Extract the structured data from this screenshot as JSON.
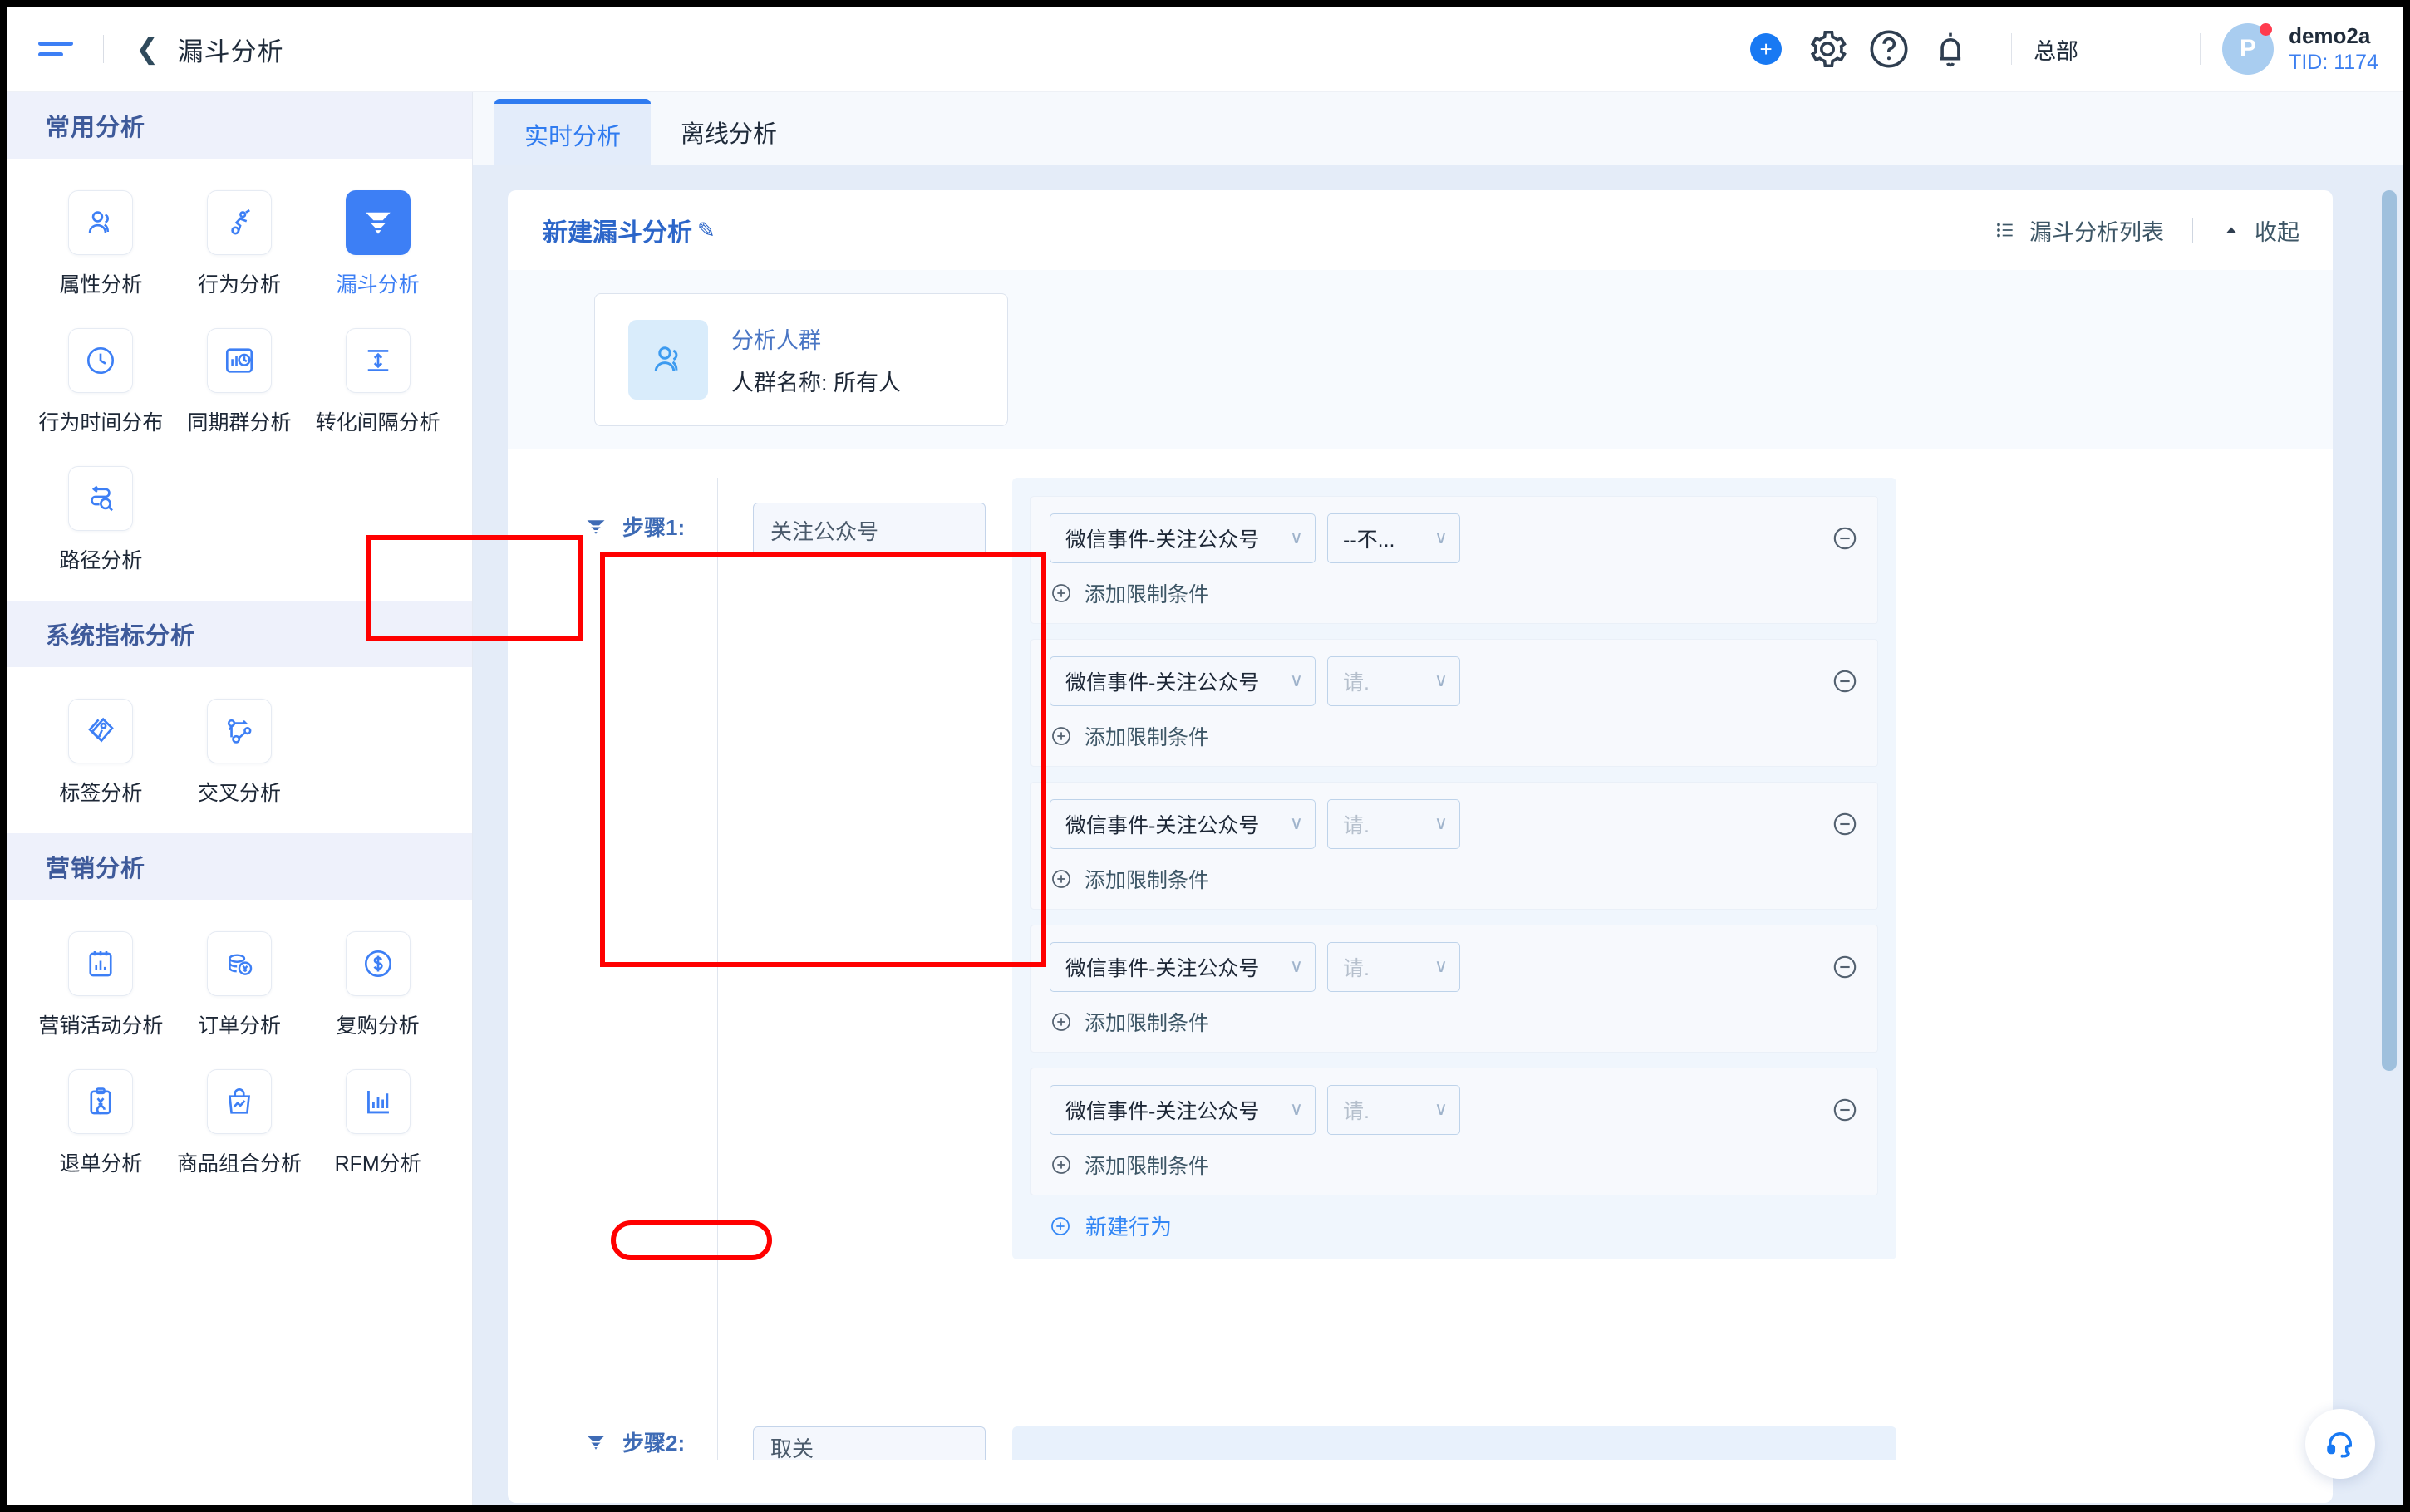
{
  "topbar": {
    "menu_icon": "hamburger-icon",
    "back_icon": "chevron-left-icon",
    "title": "漏斗分析",
    "icons": [
      "plus-icon",
      "gear-icon",
      "help-icon",
      "bell-icon"
    ],
    "org": "总部",
    "avatar_initial": "P",
    "user_name": "demo2a",
    "user_tid": "TID: 1174"
  },
  "sidebar": {
    "sections": [
      {
        "title": "常用分析",
        "items": [
          {
            "label": "属性分析",
            "icon": "users-icon",
            "active": false
          },
          {
            "label": "行为分析",
            "icon": "behavior-icon",
            "active": false
          },
          {
            "label": "漏斗分析",
            "icon": "funnel-icon",
            "active": true
          },
          {
            "label": "行为时间分布",
            "icon": "clock-icon",
            "active": false
          },
          {
            "label": "同期群分析",
            "icon": "cohort-icon",
            "active": false
          },
          {
            "label": "转化间隔分析",
            "icon": "interval-icon",
            "active": false
          },
          {
            "label": "路径分析",
            "icon": "path-search-icon",
            "active": false
          }
        ]
      },
      {
        "title": "系统指标分析",
        "items": [
          {
            "label": "标签分析",
            "icon": "tag-icon",
            "active": false
          },
          {
            "label": "交叉分析",
            "icon": "cross-icon",
            "active": false
          }
        ]
      },
      {
        "title": "营销分析",
        "items": [
          {
            "label": "营销活动分析",
            "icon": "campaign-chart-icon",
            "active": false
          },
          {
            "label": "订单分析",
            "icon": "coins-icon",
            "active": false
          },
          {
            "label": "复购分析",
            "icon": "dollar-circle-icon",
            "active": false
          },
          {
            "label": "退单分析",
            "icon": "refund-icon",
            "active": false
          },
          {
            "label": "商品组合分析",
            "icon": "bag-trend-icon",
            "active": false
          },
          {
            "label": "RFM分析",
            "icon": "bar-chart-icon",
            "active": false
          }
        ]
      }
    ]
  },
  "tabs": [
    {
      "label": "实时分析",
      "active": true
    },
    {
      "label": "离线分析",
      "active": false
    }
  ],
  "card": {
    "title": "新建漏斗分析",
    "edit_icon": "pencil-icon",
    "list_icon": "list-icon",
    "list_label": "漏斗分析列表",
    "collapse_icon": "caret-up-icon",
    "collapse_label": "收起"
  },
  "crowd": {
    "icon": "users-icon",
    "title": "分析人群",
    "detail": "人群名称: 所有人"
  },
  "step": {
    "funnel_icon": "funnel-icon",
    "label": "步骤1:",
    "name_value": "关注公众号"
  },
  "conditions": [
    {
      "event": "微信事件-关注公众号",
      "operator": "--不...",
      "operator_is_placeholder": false,
      "add_limit": "添加限制条件",
      "remove_icon": "minus-circle-icon",
      "add_icon": "plus-circle-icon"
    },
    {
      "event": "微信事件-关注公众号",
      "operator": "请.",
      "operator_is_placeholder": true,
      "add_limit": "添加限制条件",
      "remove_icon": "minus-circle-icon",
      "add_icon": "plus-circle-icon"
    },
    {
      "event": "微信事件-关注公众号",
      "operator": "请.",
      "operator_is_placeholder": true,
      "add_limit": "添加限制条件",
      "remove_icon": "minus-circle-icon",
      "add_icon": "plus-circle-icon"
    },
    {
      "event": "微信事件-关注公众号",
      "operator": "请.",
      "operator_is_placeholder": true,
      "add_limit": "添加限制条件",
      "remove_icon": "minus-circle-icon",
      "add_icon": "plus-circle-icon"
    },
    {
      "event": "微信事件-关注公众号",
      "operator": "请.",
      "operator_is_placeholder": true,
      "add_limit": "添加限制条件",
      "remove_icon": "minus-circle-icon",
      "add_icon": "plus-circle-icon"
    }
  ],
  "new_behavior": {
    "icon": "plus-circle-icon",
    "label": "新建行为"
  },
  "step2_peek": {
    "label": "步骤2:",
    "name_value": "取关"
  },
  "support": {
    "icon": "headset-icon"
  },
  "colors": {
    "accent": "#3d7ff5",
    "tab_active": "#2f7bf0",
    "title_blue": "#2c66c9",
    "page_bg": "#e4ecf8",
    "annotation_red": "#ff0000"
  }
}
